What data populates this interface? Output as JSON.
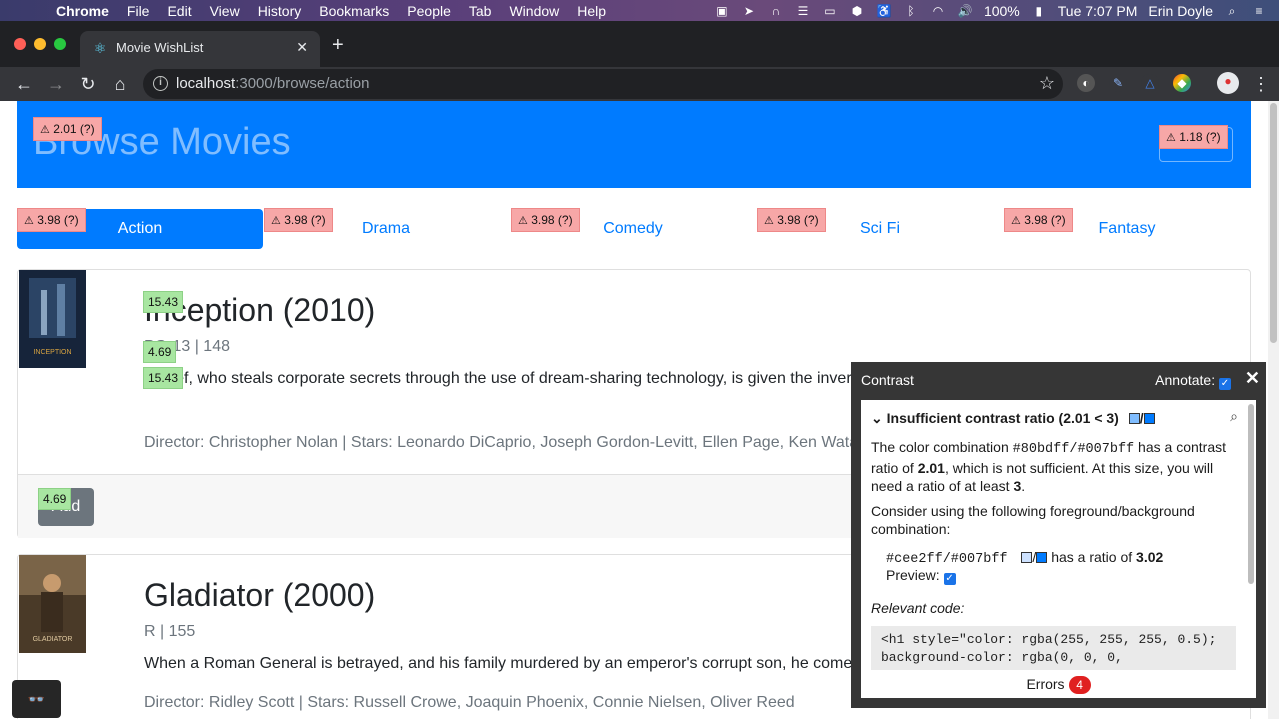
{
  "menubar": {
    "app": "Chrome",
    "items": [
      "File",
      "Edit",
      "View",
      "History",
      "Bookmarks",
      "People",
      "Tab",
      "Window",
      "Help"
    ],
    "battery": "100%",
    "clock": "Tue 7:07 PM",
    "user": "Erin Doyle"
  },
  "browser": {
    "tab_title": "Movie WishList",
    "url_host": "localhost",
    "url_path": ":3000/browse/action"
  },
  "page": {
    "heading": "Browse Movies",
    "tabs": [
      "Action",
      "Drama",
      "Comedy",
      "Sci Fi",
      "Fantasy"
    ],
    "badges": {
      "heading": "2.01",
      "header_button": "1.18",
      "nav": "3.98",
      "q": "(?)",
      "title1": "15.43",
      "meta1": "4.69",
      "desc1": "15.43",
      "add": "4.69"
    },
    "movies": [
      {
        "title": "Inception (2010)",
        "meta": "PG-13 | 148",
        "description": "A thief, who steals corporate secrets through the use of dream-sharing technology, is given the inverse task of planting an idea into the mind of a CEO.",
        "credits": "Director: Christopher Nolan | Stars: Leonardo DiCaprio, Joseph Gordon-Levitt, Ellen Page, Ken Watanabe",
        "add_label": "Add",
        "poster_text": "INCEPTION"
      },
      {
        "title": "Gladiator (2000)",
        "meta": "R | 155",
        "description": "When a Roman General is betrayed, and his family murdered by an emperor's corrupt son, he comes to Rome as a gladiator to seek revenge.",
        "credits": "Director: Ridley Scott | Stars: Russell Crowe, Joaquin Phoenix, Connie Nielsen, Oliver Reed",
        "poster_text": "GLADIATOR"
      }
    ]
  },
  "contrast_panel": {
    "title": "Contrast",
    "annotate_label": "Annotate:",
    "issue_title": "Insufficient contrast ratio (2.01 < 3)",
    "text_1a": "The color combination ",
    "combo": "#80bdff/#007bff",
    "text_1b": " has a contrast ratio of ",
    "ratio": "2.01",
    "text_1c": ", which is not sufficient. At this size, you will need a ratio of at least ",
    "required": "3",
    "text_1d": ".",
    "text_2": "Consider using the following foreground/background combination:",
    "suggestion": "#cee2ff/#007bff",
    "suggestion_text": "has a ratio of ",
    "suggestion_ratio": "3.02",
    "preview_label": "Preview:",
    "relevant_label": "Relevant code:",
    "code": "<h1 style=\"color: rgba(255, 255, 255, 0.5); background-color: rgba(0, 0, 0,",
    "errors_label": "Errors",
    "errors_count": "4"
  },
  "colors": {
    "primary": "#007bff",
    "fg_bad": "#80bdff",
    "fg_suggested": "#cee2ff",
    "badge_fail": "#f7a7a7",
    "badge_pass": "#a8e6a1"
  }
}
